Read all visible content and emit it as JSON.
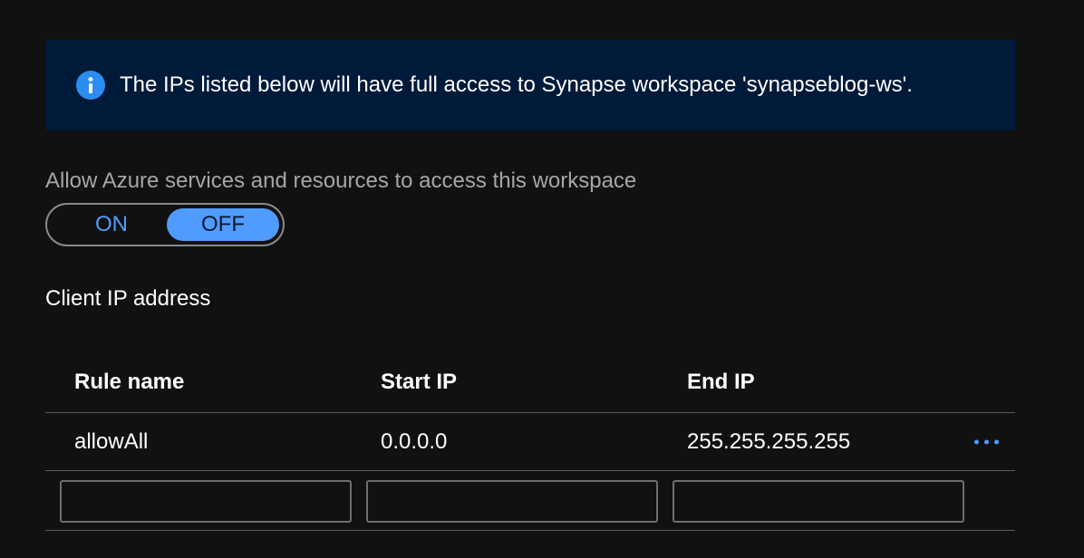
{
  "banner": {
    "icon": "info-icon",
    "text": "The IPs listed below will have full access to Synapse workspace 'synapseblog-ws'."
  },
  "azure_access": {
    "label": "Allow Azure services and resources to access this workspace",
    "on_label": "ON",
    "off_label": "OFF",
    "selected": "OFF"
  },
  "client_ip": {
    "title": "Client IP address"
  },
  "firewall_table": {
    "columns": [
      "Rule name",
      "Start IP",
      "End IP"
    ],
    "rows": [
      {
        "rule_name": "allowAll",
        "start_ip": "0.0.0.0",
        "end_ip": "255.255.255.255"
      }
    ],
    "new_rule": {
      "rule_name": "",
      "start_ip": "",
      "end_ip": ""
    },
    "row_menu_icon": "more-horizontal-icon"
  },
  "colors": {
    "background": "#111111",
    "banner_bg": "#001a3a",
    "accent": "#4f9bff",
    "info_icon": "#2d8cf0"
  }
}
